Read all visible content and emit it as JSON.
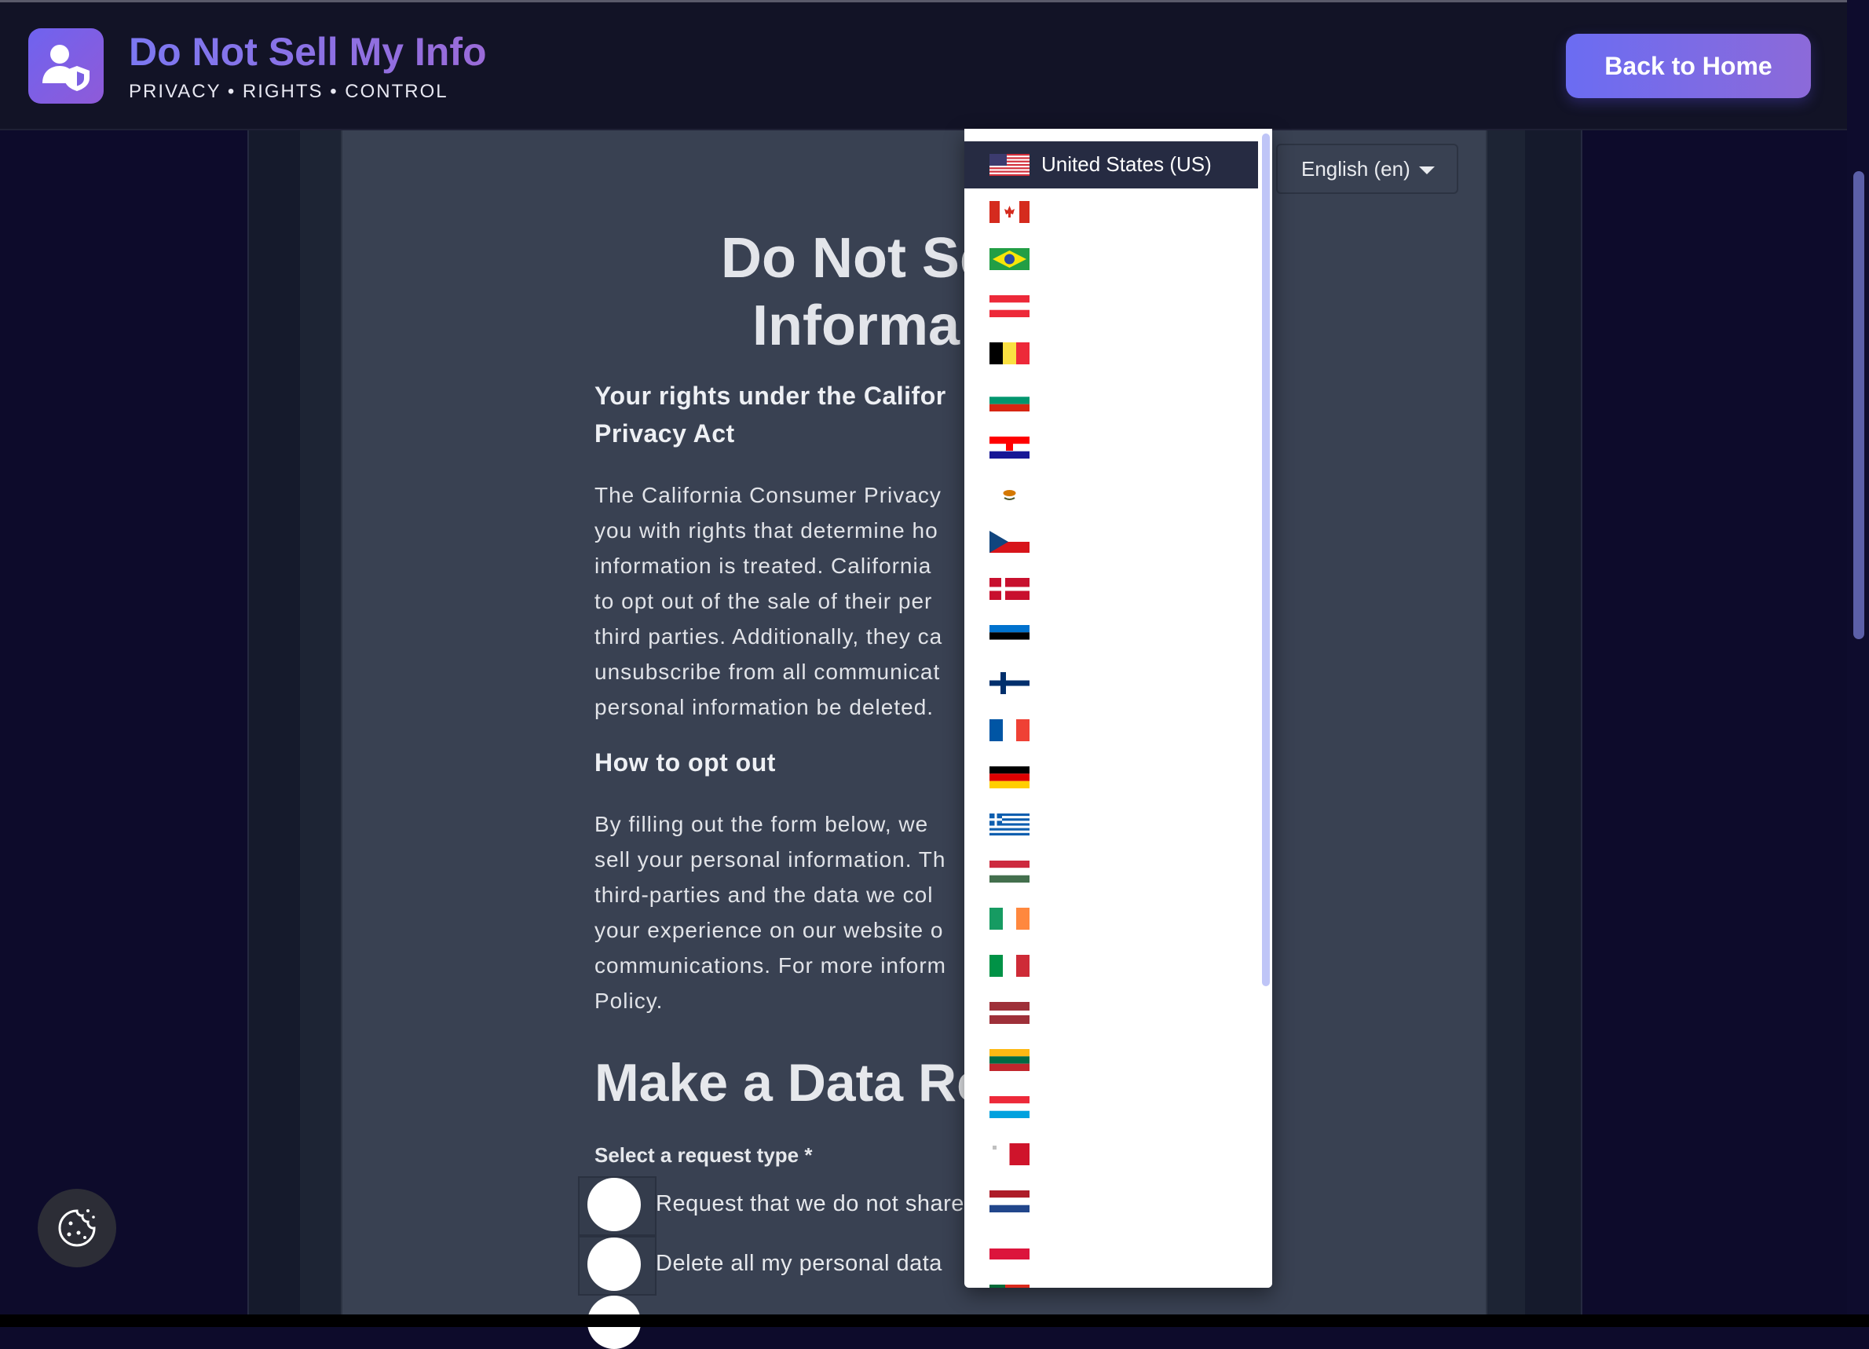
{
  "header": {
    "title": "Do Not Sell My Info",
    "subtitle": "PRIVACY • RIGHTS • CONTROL",
    "back_button": "Back to Home"
  },
  "language_select": {
    "value": "English (en)"
  },
  "country_dropdown": {
    "selected_label": "United States (US)",
    "items": [
      {
        "flag": "us-flag-icon"
      },
      {
        "flag": "ca-flag-icon"
      },
      {
        "flag": "br-flag-icon"
      },
      {
        "flag": "at-flag-icon"
      },
      {
        "flag": "be-flag-icon"
      },
      {
        "flag": "bg-flag-icon"
      },
      {
        "flag": "hr-flag-icon"
      },
      {
        "flag": "cy-flag-icon"
      },
      {
        "flag": "cz-flag-icon"
      },
      {
        "flag": "dk-flag-icon"
      },
      {
        "flag": "ee-flag-icon"
      },
      {
        "flag": "fi-flag-icon"
      },
      {
        "flag": "fr-flag-icon"
      },
      {
        "flag": "de-flag-icon"
      },
      {
        "flag": "gr-flag-icon"
      },
      {
        "flag": "hu-flag-icon"
      },
      {
        "flag": "ie-flag-icon"
      },
      {
        "flag": "it-flag-icon"
      },
      {
        "flag": "lv-flag-icon"
      },
      {
        "flag": "lt-flag-icon"
      },
      {
        "flag": "lu-flag-icon"
      },
      {
        "flag": "mt-flag-icon"
      },
      {
        "flag": "nl-flag-icon"
      },
      {
        "flag": "pl-flag-icon"
      },
      {
        "flag": "pt-flag-icon"
      }
    ]
  },
  "main": {
    "title_line1": "Do Not Se",
    "title_line2": "Informa",
    "rights_heading": "Your rights under the Califor\nPrivacy Act",
    "rights_text": "The California Consumer Privacy\nyou with rights that determine ho\ninformation is treated. California\nto opt out of the sale of their per\nthird parties. Additionally, they ca\nunsubscribe from all communicat\npersonal information be deleted.",
    "optout_heading": "How to opt out",
    "optout_text": "By filling out the form below, we\nsell your personal information. Th\nthird-parties and the data we col\nyour experience on our website o\ncommunications. For more inform\nPolicy.",
    "request_heading": "Make a Data Re",
    "request_type_label": "Select a request type *",
    "options": [
      "Request that we do not share",
      "Delete all my personal data"
    ]
  },
  "colors": {
    "background": "#0d0b2b",
    "header": "#121326",
    "card": "#394152",
    "accent": "#6b6cf2",
    "dropdown_selected": "#262b42"
  }
}
